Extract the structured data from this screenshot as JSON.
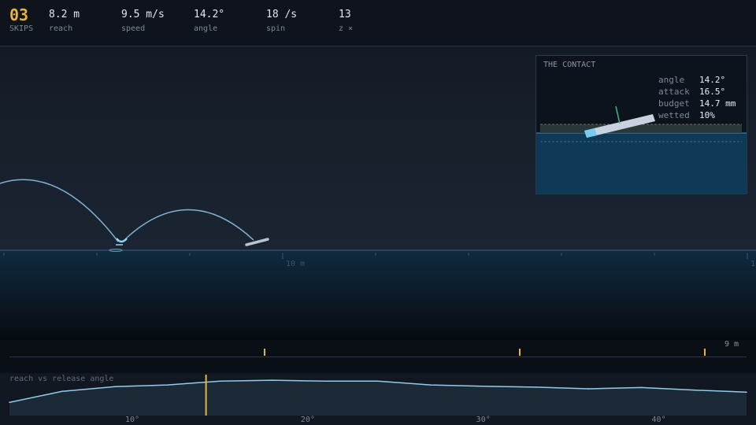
{
  "stats": {
    "skips": {
      "value": "03",
      "label": "SKIPS"
    },
    "reach": {
      "value": "8.2 m",
      "label": "reach"
    },
    "speed": {
      "value": "9.5 m/s",
      "label": "speed"
    },
    "angle": {
      "value": "14.2°",
      "label": "angle"
    },
    "spin": {
      "value": "18 /s",
      "label": "spin"
    },
    "zoom": {
      "value": "13",
      "label": "z ×"
    }
  },
  "scene": {
    "distance_labels": [
      "10 m",
      "1"
    ]
  },
  "contact": {
    "title": "THE CONTACT",
    "rows": [
      {
        "key": "angle",
        "value": "14.2°"
      },
      {
        "key": "attack",
        "value": "16.5°"
      },
      {
        "key": "budget",
        "value": "14.7 mm"
      },
      {
        "key": "wetted",
        "value": "10%"
      }
    ]
  },
  "timeline": {
    "end_label": "9 m"
  },
  "chart_data": {
    "type": "area",
    "title": "reach vs release angle",
    "xlabel": "",
    "ylabel": "",
    "x_tick_labels": [
      "10°",
      "20°",
      "30°",
      "40°"
    ],
    "xlim": [
      3,
      45
    ],
    "ylim": [
      0,
      10
    ],
    "marker_x": 14.2,
    "x": [
      3,
      6,
      9,
      12,
      15,
      18,
      21,
      24,
      27,
      30,
      33,
      36,
      39,
      42,
      45
    ],
    "values": [
      3.1,
      5.7,
      6.8,
      7.2,
      8.1,
      8.3,
      8.1,
      8.1,
      7.2,
      6.9,
      6.7,
      6.3,
      6.6,
      6.0,
      5.5
    ],
    "colors": {
      "line": "#8fcdea",
      "marker": "#e7b43d"
    }
  }
}
